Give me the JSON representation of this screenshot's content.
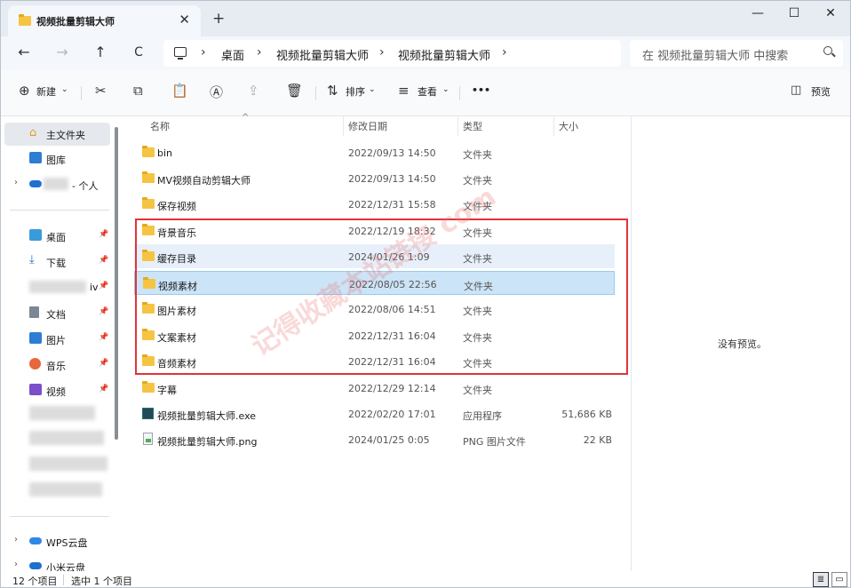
{
  "window": {
    "tab_title": "视频批量剪辑大师",
    "tab_close": "✕",
    "new_tab": "+",
    "minimize": "—",
    "maximize": "☐",
    "close": "✕"
  },
  "nav": {
    "back": "←",
    "forward": "→",
    "up": "↑",
    "refresh": "C",
    "breadcrumbs": [
      "桌面",
      "视频批量剪辑大师",
      "视频批量剪辑大师"
    ],
    "sep": "›",
    "search_placeholder": "在 视频批量剪辑大师 中搜索"
  },
  "toolbar": {
    "new_label": "新建",
    "sort_label": "排序",
    "view_label": "查看",
    "more": "•••",
    "preview_label": "预览"
  },
  "sidebar": {
    "home": "主文件夹",
    "gallery": "图库",
    "personal": "- 个人",
    "desktop": "桌面",
    "downloads": "下载",
    "blurred_suffix": "iv",
    "documents": "文档",
    "pictures": "图片",
    "music": "音乐",
    "videos": "视频",
    "wps": "WPS云盘",
    "xiaomi": "小米云盘",
    "pin": "📌",
    "chevron": "›"
  },
  "columns": {
    "name": "名称",
    "date": "修改日期",
    "type": "类型",
    "size": "大小",
    "sort_indicator": "^"
  },
  "files": [
    {
      "name": "bin",
      "date": "2022/09/13 14:50",
      "type": "文件夹",
      "size": ""
    },
    {
      "name": "MV视频自动剪辑大师",
      "date": "2022/09/13 14:50",
      "type": "文件夹",
      "size": ""
    },
    {
      "name": "保存视频",
      "date": "2022/12/31 15:58",
      "type": "文件夹",
      "size": ""
    },
    {
      "name": "背景音乐",
      "date": "2022/12/19 18:32",
      "type": "文件夹",
      "size": ""
    },
    {
      "name": "缓存目录",
      "date": "2024/01/26 1:09",
      "type": "文件夹",
      "size": ""
    },
    {
      "name": "视频素材",
      "date": "2022/08/05 22:56",
      "type": "文件夹",
      "size": ""
    },
    {
      "name": "图片素材",
      "date": "2022/08/06 14:51",
      "type": "文件夹",
      "size": ""
    },
    {
      "name": "文案素材",
      "date": "2022/12/31 16:04",
      "type": "文件夹",
      "size": ""
    },
    {
      "name": "音频素材",
      "date": "2022/12/31 16:04",
      "type": "文件夹",
      "size": ""
    },
    {
      "name": "字幕",
      "date": "2022/12/29 12:14",
      "type": "文件夹",
      "size": ""
    },
    {
      "name": "视频批量剪辑大师.exe",
      "date": "2022/02/20 17:01",
      "type": "应用程序",
      "size": "51,686 KB"
    },
    {
      "name": "视频批量剪辑大师.png",
      "date": "2024/01/25 0:05",
      "type": "PNG 图片文件",
      "size": "22 KB"
    }
  ],
  "preview_pane": {
    "empty_text": "没有预览。"
  },
  "watermark": "记得收藏本站链接 com",
  "status": {
    "item_count": "12 个项目",
    "selected": "选中 1 个项目"
  },
  "colors": {
    "selection": "#cce4f7",
    "hover": "#e7f0fa",
    "highlight_border": "#e0343a",
    "folder": "#f6c443"
  }
}
